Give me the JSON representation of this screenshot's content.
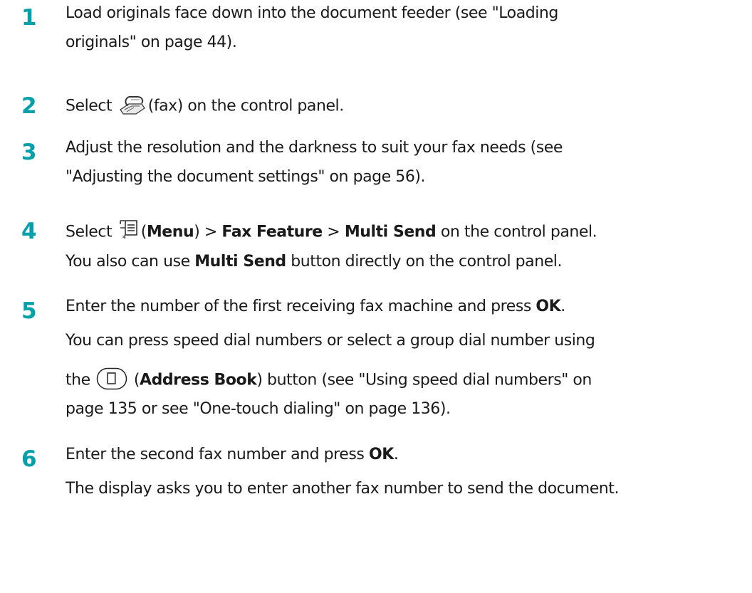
{
  "steps": [
    {
      "number": "1",
      "lines": [
        {
          "parts": [
            {
              "t": "Load originals face down into the document feeder (see \"Loading"
            }
          ]
        },
        {
          "parts": [
            {
              "t": "originals\" on page 44)."
            }
          ]
        }
      ]
    },
    {
      "number": "2",
      "lines": [
        {
          "parts": [
            {
              "t": "Select "
            },
            {
              "icon": "fax-icon"
            },
            {
              "t": "(fax) on the control panel."
            }
          ]
        }
      ]
    },
    {
      "number": "3",
      "lines": [
        {
          "parts": [
            {
              "t": "Adjust the resolution and the darkness to suit your fax needs (see"
            }
          ]
        },
        {
          "parts": [
            {
              "t": "\"Adjusting the document settings\" on page 56)."
            }
          ]
        }
      ]
    },
    {
      "number": "4",
      "lines": [
        {
          "parts": [
            {
              "t": "Select "
            },
            {
              "icon": "menu-icon"
            },
            {
              "t": "("
            },
            {
              "t": "Menu",
              "b": true
            },
            {
              "t": ") > "
            },
            {
              "t": "Fax Feature",
              "b": true
            },
            {
              "t": " > "
            },
            {
              "t": "Multi Send",
              "b": true
            },
            {
              "t": " on the control panel."
            }
          ]
        },
        {
          "parts": [
            {
              "t": "You also can use "
            },
            {
              "t": "Multi Send",
              "b": true
            },
            {
              "t": " button directly on the control panel."
            }
          ]
        }
      ]
    },
    {
      "number": "5",
      "lines": [
        {
          "parts": [
            {
              "t": "Enter the number of the first receiving fax machine and press "
            },
            {
              "t": "OK",
              "b": true
            },
            {
              "t": "."
            }
          ]
        },
        {
          "parts": [
            {
              "t": "You can press speed dial numbers or select a group dial number using"
            }
          ]
        },
        {
          "parts": [
            {
              "t": "the "
            },
            {
              "icon": "address-book-icon"
            },
            {
              "t": " ("
            },
            {
              "t": "Address Book",
              "b": true
            },
            {
              "t": ") button (see \"Using speed dial numbers\" on"
            }
          ]
        },
        {
          "parts": [
            {
              "t": "page 135  or see \"One-touch dialing\" on page 136)."
            }
          ]
        }
      ]
    },
    {
      "number": "6",
      "lines": [
        {
          "parts": [
            {
              "t": "Enter the second fax number and press "
            },
            {
              "t": "OK",
              "b": true
            },
            {
              "t": "."
            }
          ]
        },
        {
          "parts": [
            {
              "t": "The display asks you to enter another fax number to send the document."
            }
          ]
        }
      ]
    }
  ],
  "colors": {
    "step_number": "#00a0ab",
    "text": "#1a1a1a"
  }
}
